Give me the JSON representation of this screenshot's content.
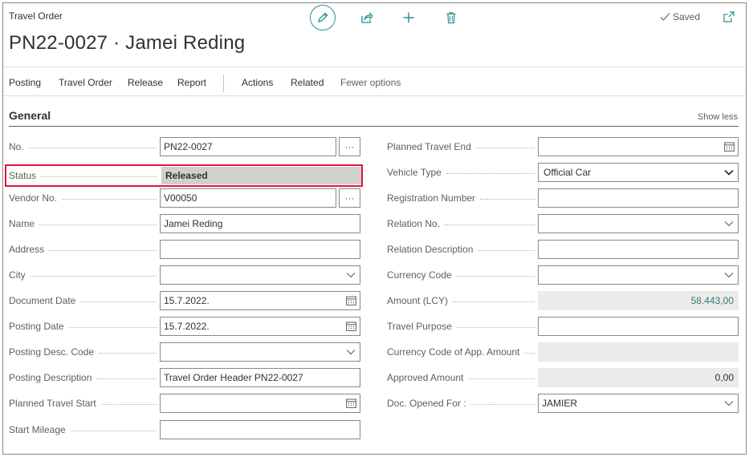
{
  "header": {
    "caption": "Travel Order",
    "title": "PN22-0027 · Jamei Reding",
    "saved_label": "Saved"
  },
  "actions": {
    "posting": "Posting",
    "travel_order": "Travel Order",
    "release": "Release",
    "report": "Report",
    "actions": "Actions",
    "related": "Related",
    "fewer_options": "Fewer options"
  },
  "section": {
    "title": "General",
    "show_less": "Show less"
  },
  "left_fields": {
    "no": {
      "label": "No.",
      "value": "PN22-0027"
    },
    "status": {
      "label": "Status",
      "value": "Released"
    },
    "vendor_no": {
      "label": "Vendor No.",
      "value": "V00050"
    },
    "name": {
      "label": "Name",
      "value": "Jamei Reding"
    },
    "address": {
      "label": "Address",
      "value": ""
    },
    "city": {
      "label": "City",
      "value": ""
    },
    "document_date": {
      "label": "Document Date",
      "value": "15.7.2022."
    },
    "posting_date": {
      "label": "Posting Date",
      "value": "15.7.2022."
    },
    "posting_desc_code": {
      "label": "Posting Desc. Code",
      "value": ""
    },
    "posting_description": {
      "label": "Posting Description",
      "value": "Travel Order Header PN22-0027"
    },
    "planned_travel_start": {
      "label": "Planned Travel Start",
      "value": ""
    },
    "start_mileage": {
      "label": "Start Mileage",
      "value": ""
    }
  },
  "right_fields": {
    "planned_travel_end": {
      "label": "Planned Travel End",
      "value": ""
    },
    "vehicle_type": {
      "label": "Vehicle Type",
      "value": "Official Car"
    },
    "registration_number": {
      "label": "Registration Number",
      "value": ""
    },
    "relation_no": {
      "label": "Relation No.",
      "value": ""
    },
    "relation_description": {
      "label": "Relation Description",
      "value": ""
    },
    "currency_code": {
      "label": "Currency Code",
      "value": ""
    },
    "amount_lcy": {
      "label": "Amount (LCY)",
      "value": "58.443,00"
    },
    "travel_purpose": {
      "label": "Travel Purpose",
      "value": ""
    },
    "currency_code_app": {
      "label": "Currency Code of App. Amount",
      "value": ""
    },
    "approved_amount": {
      "label": "Approved Amount",
      "value": "0,00"
    },
    "doc_opened_for": {
      "label": "Doc. Opened For :",
      "value": "JAMIER"
    }
  },
  "colors": {
    "accent": "#2a8f8f",
    "highlight": "#e2153d",
    "readonly_bg": "#edebe9"
  },
  "icons": [
    "edit-icon",
    "share-icon",
    "add-icon",
    "delete-icon",
    "checkmark-icon",
    "popout-icon",
    "ellipsis-icon",
    "calendar-icon",
    "chevron-down-icon"
  ]
}
